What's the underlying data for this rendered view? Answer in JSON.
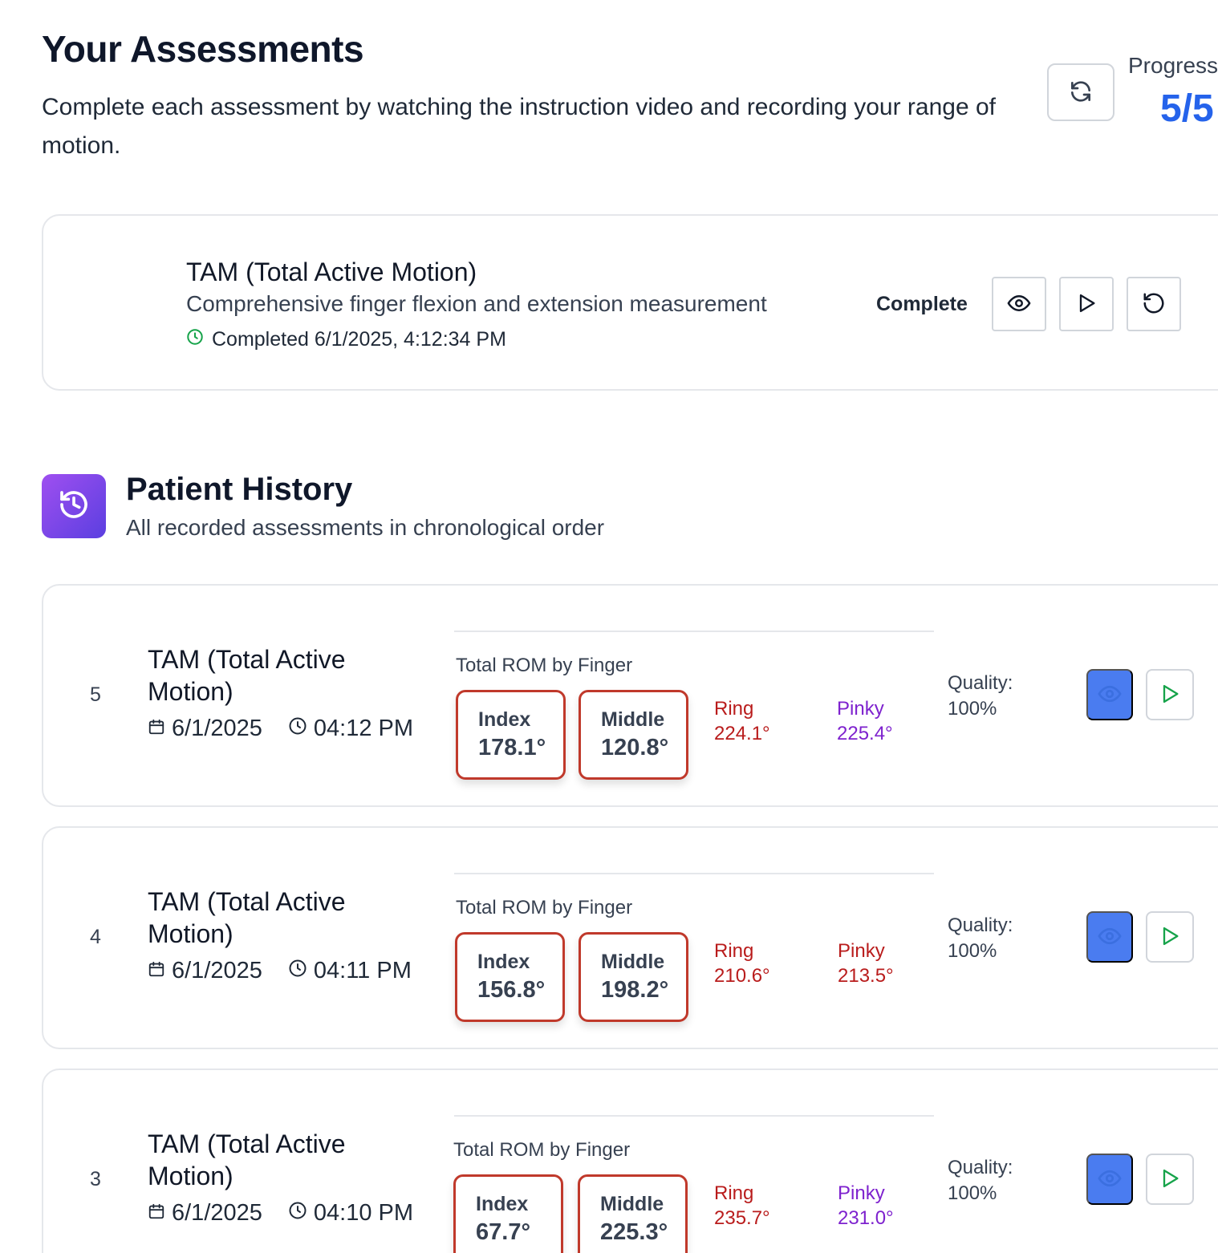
{
  "header": {
    "title": "Your Assessments",
    "subtitle": "Complete each assessment by watching the instruction video and recording your range of motion.",
    "progress_label": "Progress",
    "progress_value": "5/5"
  },
  "assessment": {
    "title": "TAM (Total Active Motion)",
    "description": "Comprehensive finger flexion and extension measurement",
    "completed": "Completed 6/1/2025, 4:12:34 PM",
    "status": "Complete"
  },
  "history": {
    "title": "Patient History",
    "subtitle": "All recorded assessments in chronological order",
    "rom_label": "Total ROM by Finger",
    "quality_label": "Quality:",
    "entries": [
      {
        "number": "5",
        "title": "TAM (Total Active Motion)",
        "date": "6/1/2025",
        "time": "04:12 PM",
        "index_label": "Index",
        "index_value": "178.1°",
        "middle_label": "Middle",
        "middle_value": "120.8°",
        "ring_label": "Ring",
        "ring_value": "224.1°",
        "pinky_label": "Pinky",
        "pinky_value": "225.4°",
        "quality": "100%"
      },
      {
        "number": "4",
        "title": "TAM (Total Active Motion)",
        "date": "6/1/2025",
        "time": "04:11 PM",
        "index_label": "Index",
        "index_value": "156.8°",
        "middle_label": "Middle",
        "middle_value": "198.2°",
        "ring_label": "Ring",
        "ring_value": "210.6°",
        "pinky_label": "Pinky",
        "pinky_value": "213.5°",
        "quality": "100%"
      },
      {
        "number": "3",
        "title": "TAM (Total Active Motion)",
        "date": "6/1/2025",
        "time": "04:10 PM",
        "index_label": "Index",
        "index_value": "67.7°",
        "middle_label": "Middle",
        "middle_value": "225.3°",
        "ring_label": "Ring",
        "ring_value": "235.7°",
        "pinky_label": "Pinky",
        "pinky_value": "231.0°",
        "quality": "100%"
      }
    ]
  },
  "colors": {
    "accent_blue": "#2563eb",
    "eye_button_blue": "#4a7cf0",
    "finger_border_red": "#c0392b",
    "ring_red": "#b91c1c",
    "pinky_purple": "#7e22ce",
    "pinky_red": "#b91c1c",
    "completed_green": "#16a34a",
    "play_green": "#16a34a"
  },
  "icons": {
    "refresh": "refresh-icon",
    "clock": "clock-icon",
    "eye": "eye-icon",
    "play": "play-icon",
    "retry": "rotate-ccw-icon",
    "history": "history-icon",
    "calendar": "calendar-icon"
  }
}
